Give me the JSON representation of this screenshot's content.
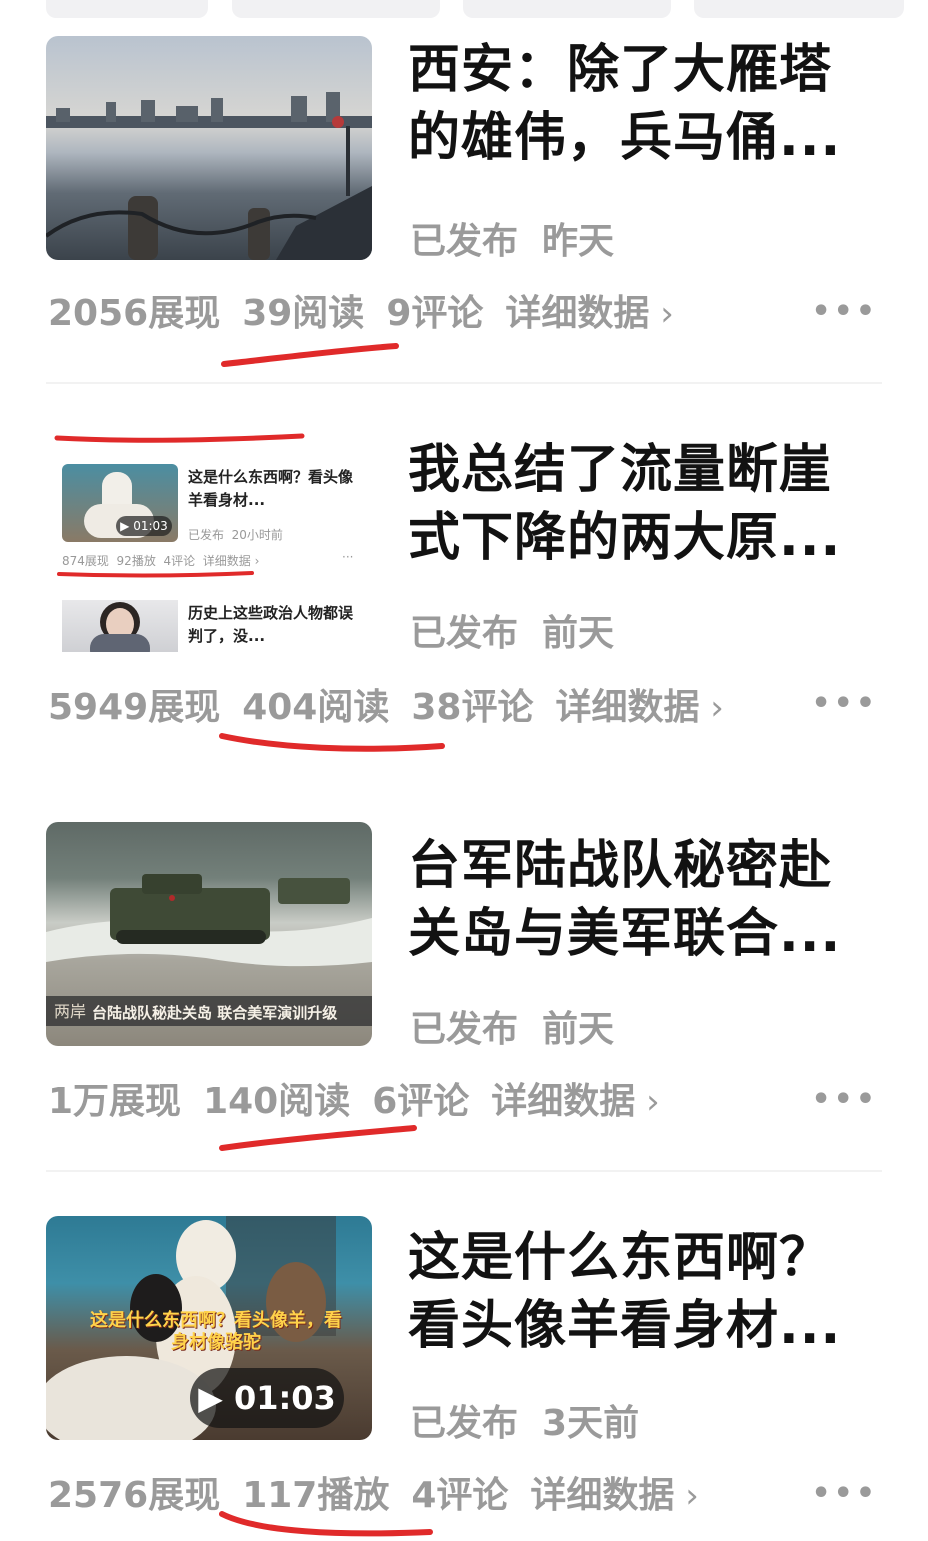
{
  "colors": {
    "underline": "#e02a2a",
    "muted": "#9a9a9a",
    "title": "#121212"
  },
  "posts": [
    {
      "title": "西安：除了大雁塔的雄伟，兵马俑...",
      "status": "已发布",
      "time": "昨天",
      "impressions": "2056展现",
      "reads": "39阅读",
      "comments": "9评论",
      "details": "详细数据",
      "more_icon": "more-icon"
    },
    {
      "title": "我总结了流量断崖式下降的两大原...",
      "status": "已发布",
      "time": "前天",
      "impressions": "5949展现",
      "reads": "404阅读",
      "comments": "38评论",
      "details": "详细数据",
      "more_icon": "more-icon",
      "embedded": {
        "item1_title": "这是什么东西啊？看头像羊看身材...",
        "item1_duration": "01:03",
        "item1_status": "已发布",
        "item1_time": "20小时前",
        "item1_impressions": "874展现",
        "item1_plays": "92播放",
        "item1_comments": "4评论",
        "item1_details": "详细数据 ›",
        "item2_title": "历史上这些政治人物都误判了，没..."
      }
    },
    {
      "title": "台军陆战队秘密赴关岛与美军联合...",
      "status": "已发布",
      "time": "前天",
      "impressions": "1万展现",
      "reads": "140阅读",
      "comments": "6评论",
      "details": "详细数据",
      "more_icon": "more-icon",
      "caption": "台陆战队秘赴关岛 联合美军演训升级"
    },
    {
      "title": "这是什么东西啊？看头像羊看身材...",
      "status": "已发布",
      "time": "3天前",
      "impressions": "2576展现",
      "reads": "117播放",
      "comments": "4评论",
      "details": "详细数据",
      "more_icon": "more-icon",
      "video_duration": "01:03",
      "video_caption": "这是什么东西啊？看头像羊，看身材像骆驼"
    }
  ]
}
